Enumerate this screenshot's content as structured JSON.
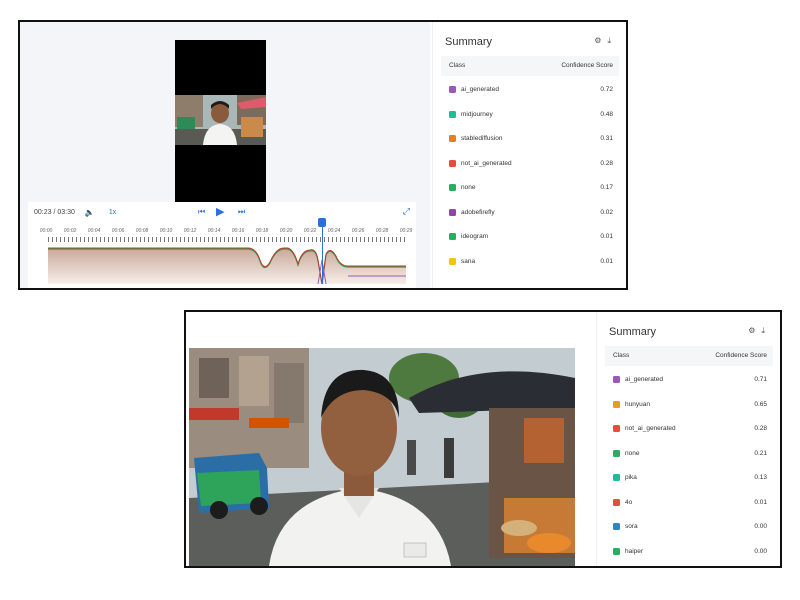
{
  "frame1": {
    "player": {
      "time": "00:23 / 03:30",
      "speed": "1x",
      "tick_labels": [
        "00:00",
        "00:02",
        "00:04",
        "00:06",
        "00:08",
        "00:10",
        "00:12",
        "00:14",
        "00:16",
        "00:18",
        "00:20",
        "00:22",
        "00:24",
        "00:26",
        "00:28",
        "00:29"
      ]
    },
    "summary": {
      "title": "Summary",
      "col_class": "Class",
      "col_score": "Confidence Score",
      "rows": [
        {
          "label": "ai_generated",
          "score": "0.72",
          "color": "#9b59b6"
        },
        {
          "label": "midjourney",
          "score": "0.48",
          "color": "#1abc9c"
        },
        {
          "label": "stablediffusion",
          "score": "0.31",
          "color": "#e67e22"
        },
        {
          "label": "not_ai_generated",
          "score": "0.28",
          "color": "#e74c3c"
        },
        {
          "label": "none",
          "score": "0.17",
          "color": "#27ae60"
        },
        {
          "label": "adobefirefly",
          "score": "0.02",
          "color": "#8e44ad"
        },
        {
          "label": "ideogram",
          "score": "0.01",
          "color": "#27ae60"
        },
        {
          "label": "sana",
          "score": "0.01",
          "color": "#f1c40f"
        }
      ]
    }
  },
  "frame2": {
    "summary": {
      "title": "Summary",
      "col_class": "Class",
      "col_score": "Confidence Score",
      "rows": [
        {
          "label": "ai_generated",
          "score": "0.71",
          "color": "#9b59b6"
        },
        {
          "label": "hunyuan",
          "score": "0.65",
          "color": "#e69b23"
        },
        {
          "label": "not_ai_generated",
          "score": "0.28",
          "color": "#e74c3c"
        },
        {
          "label": "none",
          "score": "0.21",
          "color": "#27ae60"
        },
        {
          "label": "pika",
          "score": "0.13",
          "color": "#1abc9c"
        },
        {
          "label": "4o",
          "score": "0.01",
          "color": "#e74c3c"
        },
        {
          "label": "sora",
          "score": "0.00",
          "color": "#2e86c1"
        },
        {
          "label": "haiper",
          "score": "0.00",
          "color": "#27ae60"
        }
      ]
    }
  },
  "icons": {
    "volume": "volume-icon",
    "prev": "skip-back-icon",
    "play": "play-icon",
    "next": "skip-forward-icon",
    "fullscreen": "fullscreen-icon",
    "settings": "settings-icon",
    "download": "download-icon"
  }
}
